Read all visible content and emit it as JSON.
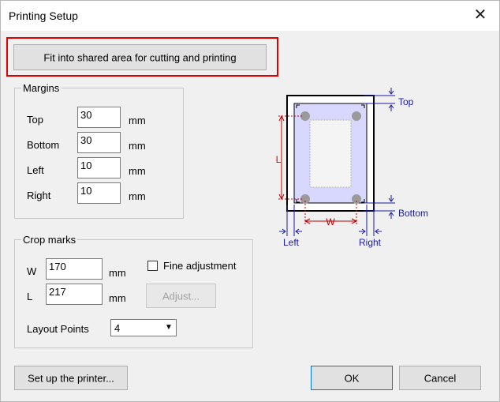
{
  "window": {
    "title": "Printing Setup",
    "close_glyph": "✕"
  },
  "fit_button": {
    "label": "Fit into shared area for cutting and printing"
  },
  "margins": {
    "legend": "Margins",
    "unit": "mm",
    "top": {
      "label": "Top",
      "value": "30"
    },
    "bottom": {
      "label": "Bottom",
      "value": "30"
    },
    "left": {
      "label": "Left",
      "value": "10"
    },
    "right": {
      "label": "Right",
      "value": "10"
    }
  },
  "crop": {
    "legend": "Crop marks",
    "unit": "mm",
    "w": {
      "label": "W",
      "value": "170"
    },
    "l": {
      "label": "L",
      "value": "217"
    },
    "fine_adjustment": {
      "label": "Fine adjustment",
      "checked": false
    },
    "adjust_button": "Adjust...",
    "layout_points": {
      "label": "Layout Points",
      "value": "4"
    }
  },
  "diagram": {
    "top": "Top",
    "bottom": "Bottom",
    "left": "Left",
    "right": "Right",
    "w": "W",
    "l": "L",
    "colors": {
      "dimension": "#1a1aa6",
      "measure": "#c00000",
      "area": "#d8d8ff"
    }
  },
  "buttons": {
    "setup_printer": "Set up the printer...",
    "ok": "OK",
    "cancel": "Cancel"
  }
}
